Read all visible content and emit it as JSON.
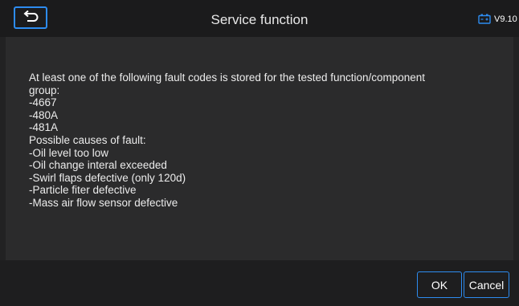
{
  "header": {
    "title": "Service function",
    "version": "V9.10",
    "back_icon": "back-arrow-icon",
    "battery_icon": "battery-icon",
    "accent_color": "#2d8cf0"
  },
  "message": {
    "lines": [
      "At least one of the following fault codes is stored for the tested function/component",
      "group:",
      "-4667",
      "-480A",
      "-481A",
      "Possible causes of fault:",
      "-Oil level too low",
      "-Oil change interal exceeded",
      "-Swirl flaps defective (only 120d)",
      "-Particle fiter defective",
      "-Mass air flow sensor defective"
    ]
  },
  "footer": {
    "ok_label": "OK",
    "cancel_label": "Cancel"
  }
}
